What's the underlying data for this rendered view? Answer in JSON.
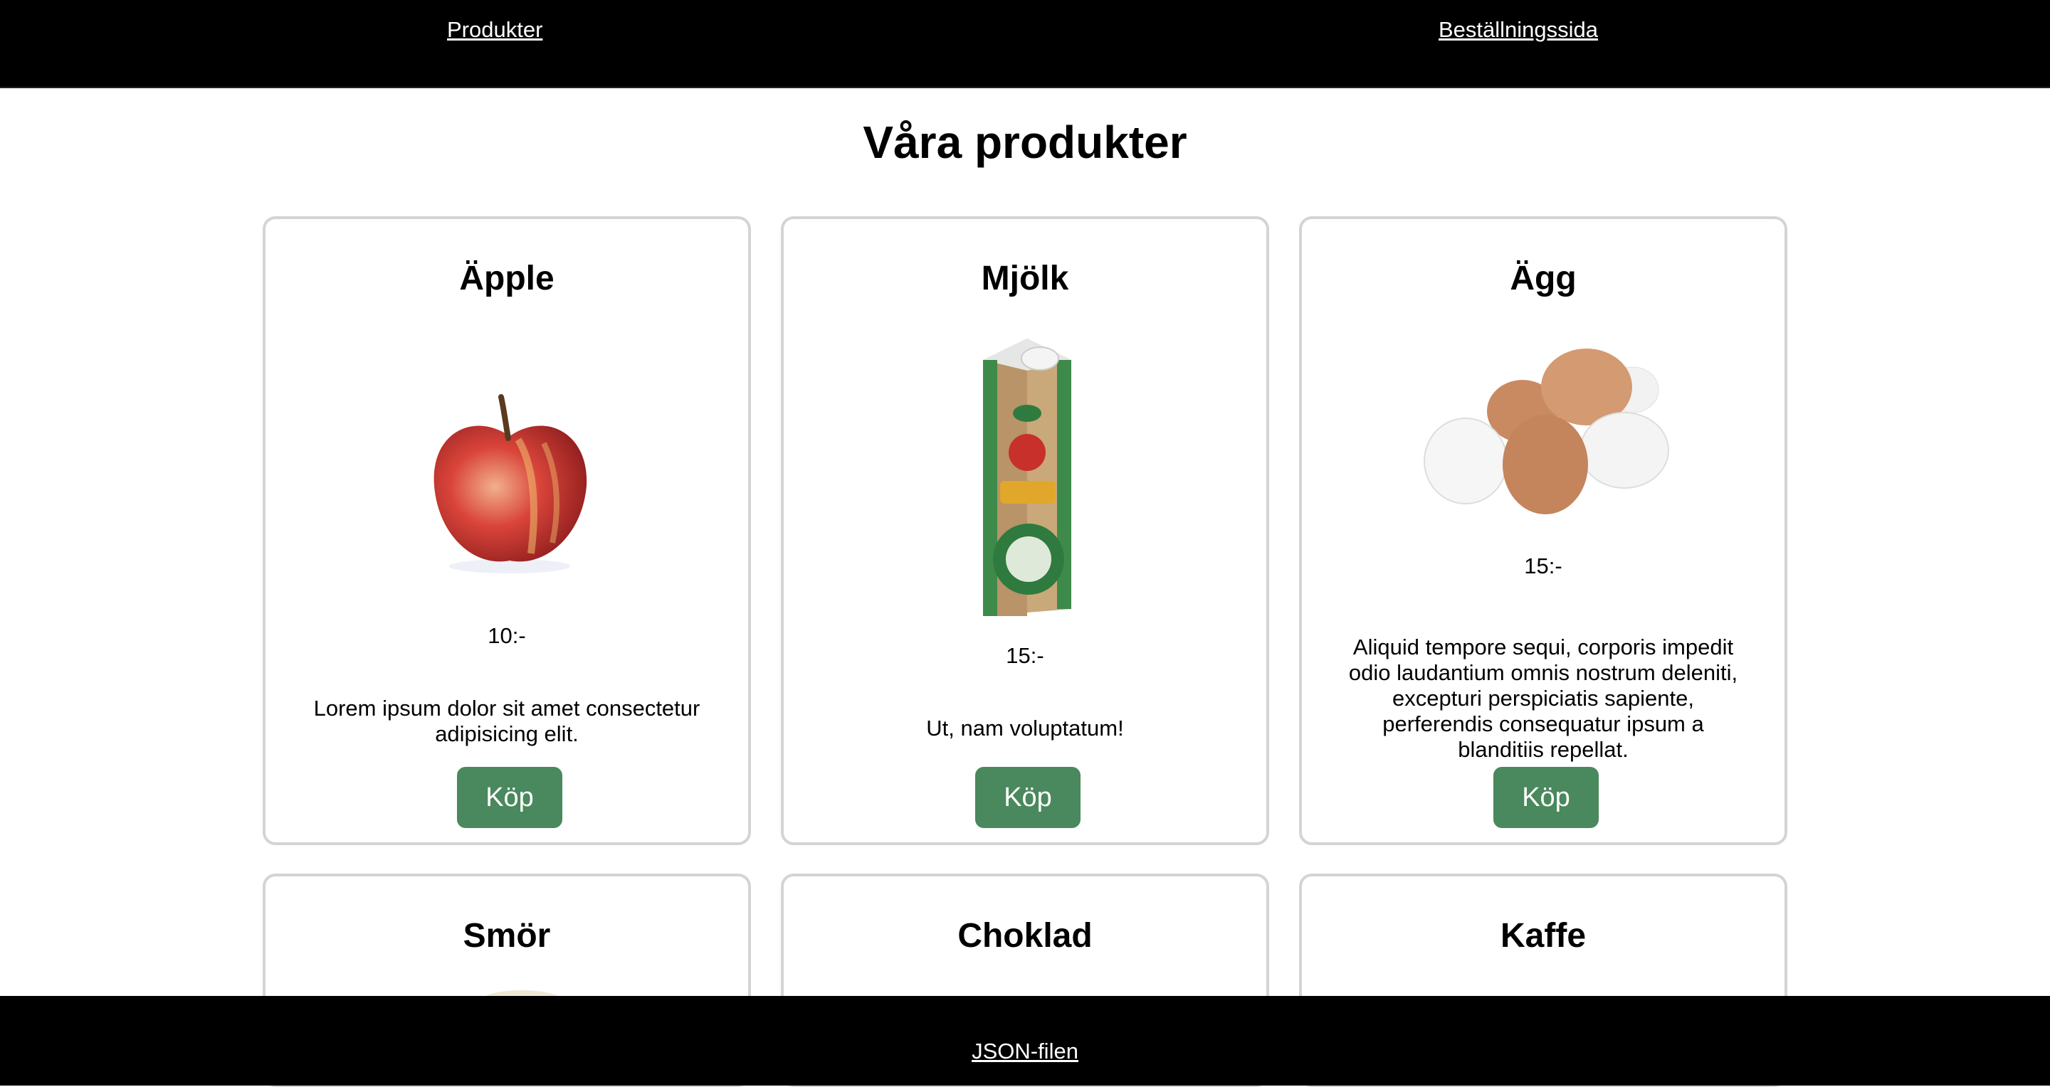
{
  "nav": {
    "products": "Produkter",
    "order": "Beställningssida"
  },
  "page": {
    "title": "Våra produkter"
  },
  "products": [
    {
      "name": "Äpple",
      "image": "apple-image",
      "price": "10:-",
      "description": "Lorem ipsum dolor sit amet consectetur adipisicing elit.",
      "button": "Köp"
    },
    {
      "name": "Mjölk",
      "image": "milk-carton-image",
      "price": "15:-",
      "description": "Ut, nam voluptatum!",
      "button": "Köp"
    },
    {
      "name": "Ägg",
      "image": "eggs-image",
      "price": "15:-",
      "description": "Aliquid tempore sequi, corporis impedit odio laudantium omnis nostrum deleniti, excepturi perspiciatis sapiente, perferendis consequatur ipsum a blanditiis repellat.",
      "button": "Köp"
    },
    {
      "name": "Smör",
      "image": "butter-image"
    },
    {
      "name": "Choklad"
    },
    {
      "name": "Kaffe"
    }
  ],
  "footer": {
    "link": "JSON-filen"
  },
  "colors": {
    "header_bg": "#000000",
    "buy_button": "#4a885d",
    "card_border": "#d4d4d4"
  }
}
